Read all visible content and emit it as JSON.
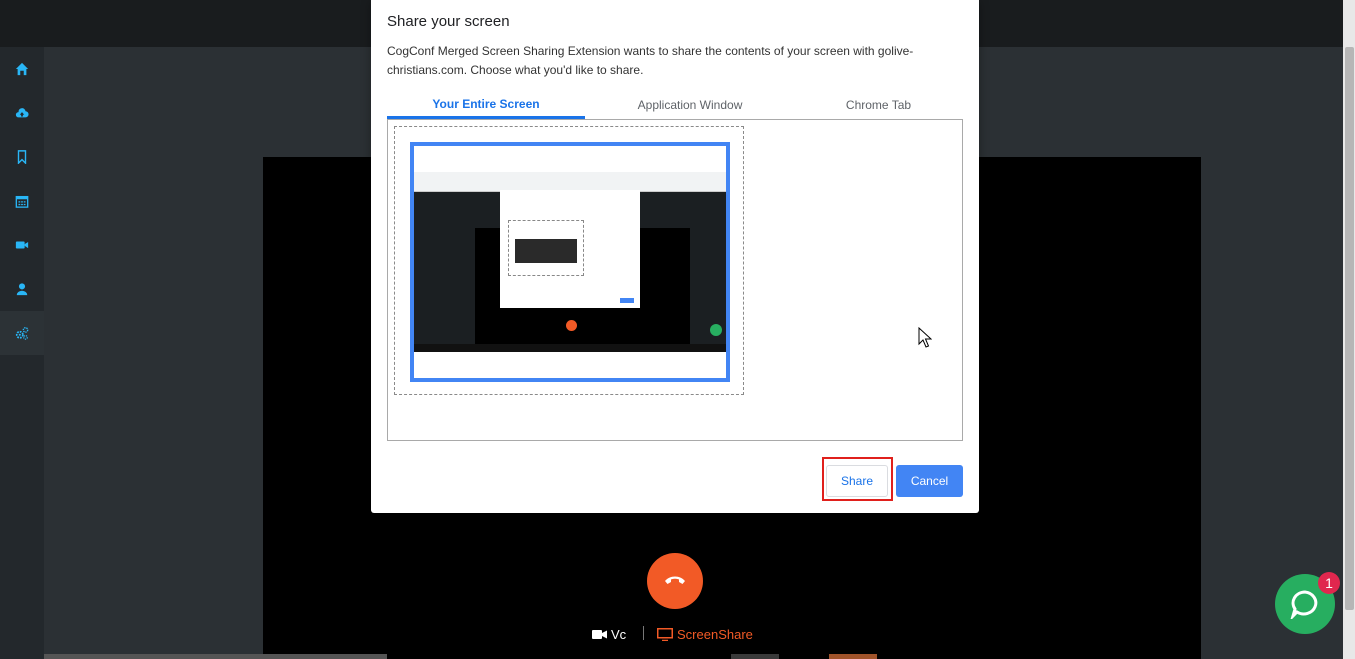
{
  "dialog": {
    "title": "Share your screen",
    "description": "CogConf Merged Screen Sharing Extension wants to share the contents of your screen with golive-christians.com. Choose what you'd like to share.",
    "tabs": [
      {
        "label": "Your Entire Screen",
        "active": true
      },
      {
        "label": "Application Window",
        "active": false
      },
      {
        "label": "Chrome Tab",
        "active": false
      }
    ],
    "share_label": "Share",
    "cancel_label": "Cancel"
  },
  "sidebar": {
    "items": [
      "home-icon",
      "cloud-upload-icon",
      "bookmark-icon",
      "calendar-icon",
      "video-icon",
      "user-icon",
      "cogs-icon"
    ]
  },
  "controls": {
    "vc_label": "Vc",
    "screenshare_label": "ScreenShare"
  },
  "chat": {
    "badge_count": "1"
  },
  "colors": {
    "accent": "#1a73e8",
    "end_call": "#f25a26",
    "sidebar_icon": "#29b6f6",
    "chat": "#27ae60",
    "highlight": "#e0201c"
  }
}
